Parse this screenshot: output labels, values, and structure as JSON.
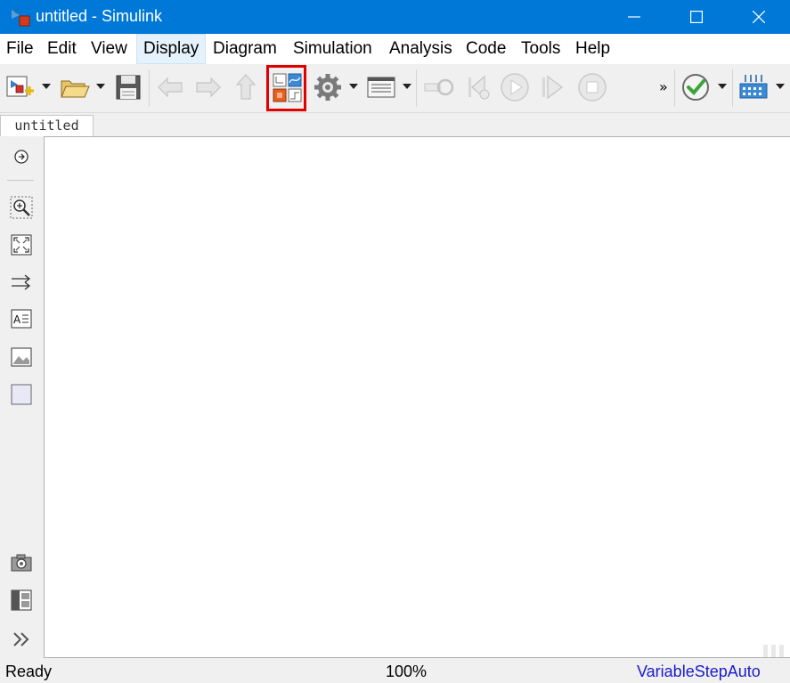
{
  "window": {
    "title": "untitled - Simulink",
    "controls": [
      "minimize",
      "maximize",
      "close"
    ]
  },
  "menu": {
    "items": [
      {
        "label": "File"
      },
      {
        "label": "Edit"
      },
      {
        "label": "View"
      },
      {
        "label": "Display"
      },
      {
        "label": "Diagram"
      },
      {
        "label": "Simulation"
      },
      {
        "label": "Analysis"
      },
      {
        "label": "Code"
      },
      {
        "label": "Tools"
      },
      {
        "label": "Help"
      }
    ],
    "active": "Display"
  },
  "toolbar": {
    "buttons": [
      {
        "icon": "new-model-icon",
        "enabled": true,
        "has_dropdown": true
      },
      {
        "icon": "open-folder-icon",
        "enabled": true,
        "has_dropdown": true
      },
      {
        "icon": "save-icon",
        "enabled": true
      },
      {
        "icon": "back-arrow-icon",
        "enabled": false
      },
      {
        "icon": "forward-arrow-icon",
        "enabled": false
      },
      {
        "icon": "up-arrow-icon",
        "enabled": false
      },
      {
        "icon": "library-browser-icon",
        "enabled": true,
        "highlighted": true
      },
      {
        "icon": "model-settings-gear-icon",
        "enabled": true,
        "has_dropdown": true
      },
      {
        "icon": "model-explorer-icon",
        "enabled": true,
        "has_dropdown": true
      },
      {
        "icon": "record-link-icon",
        "enabled": false
      },
      {
        "icon": "step-back-icon",
        "enabled": false
      },
      {
        "icon": "run-icon",
        "enabled": false
      },
      {
        "icon": "step-forward-icon",
        "enabled": false
      },
      {
        "icon": "stop-icon",
        "enabled": false
      },
      {
        "icon": "check-model-icon",
        "enabled": true,
        "has_dropdown": true
      },
      {
        "icon": "build-icon",
        "enabled": true,
        "has_dropdown": true
      }
    ],
    "overflow_label": "»",
    "highlight_color": "#e00000"
  },
  "tabs": [
    {
      "label": "untitled"
    }
  ],
  "palette": {
    "tools": [
      "hide-show-explorer-icon",
      "zoom-icon",
      "fit-to-view-icon",
      "signal-arrows-icon",
      "annotation-icon",
      "image-icon",
      "area-icon",
      "camera-icon",
      "model-browser-icon",
      "expand-double-chevron-icon"
    ],
    "expand_label": "»"
  },
  "status": {
    "state": "Ready",
    "zoom": "100%",
    "solver": "VariableStepAuto"
  },
  "colors": {
    "titlebar": "#0078d7",
    "solver_link": "#1a1ad0"
  }
}
